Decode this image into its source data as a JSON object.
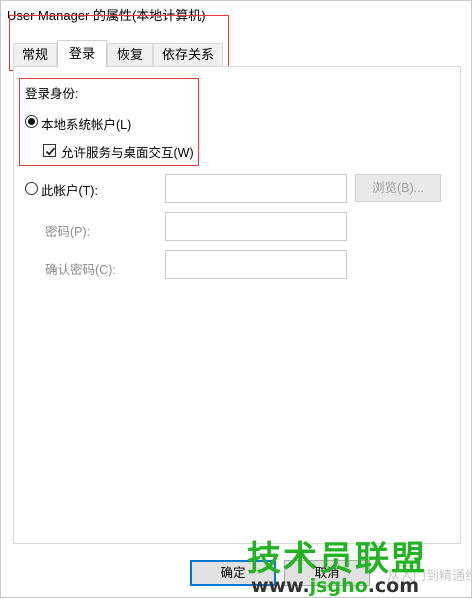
{
  "window": {
    "title": "User Manager 的属性(本地计算机)"
  },
  "tabs": [
    {
      "label": "常规"
    },
    {
      "label": "登录"
    },
    {
      "label": "恢复"
    },
    {
      "label": "依存关系"
    }
  ],
  "logon": {
    "group_label": "登录身份:",
    "local_system": {
      "label": "本地系统帐户(L)",
      "selected": true
    },
    "allow_desktop": {
      "label": "允许服务与桌面交互(W)",
      "checked": true
    },
    "this_account": {
      "label": "此帐户(T):",
      "selected": false,
      "value": ""
    },
    "browse_button": "浏览(B)...",
    "password": {
      "label": "密码(P):",
      "value": ""
    },
    "confirm_password": {
      "label": "确认密码(C):",
      "value": ""
    }
  },
  "footer": {
    "ok_label": "确定",
    "cancel_label": "取消"
  },
  "watermark": {
    "brand": "技术员联盟",
    "url_prefix": "www.",
    "url_domain": "jsgho",
    "url_suffix": ".com",
    "ghost_text": "从入门到精通经验"
  },
  "colors": {
    "highlight": "#e53c3c",
    "focus": "#0078d7",
    "watermark_green": "#22b322"
  }
}
